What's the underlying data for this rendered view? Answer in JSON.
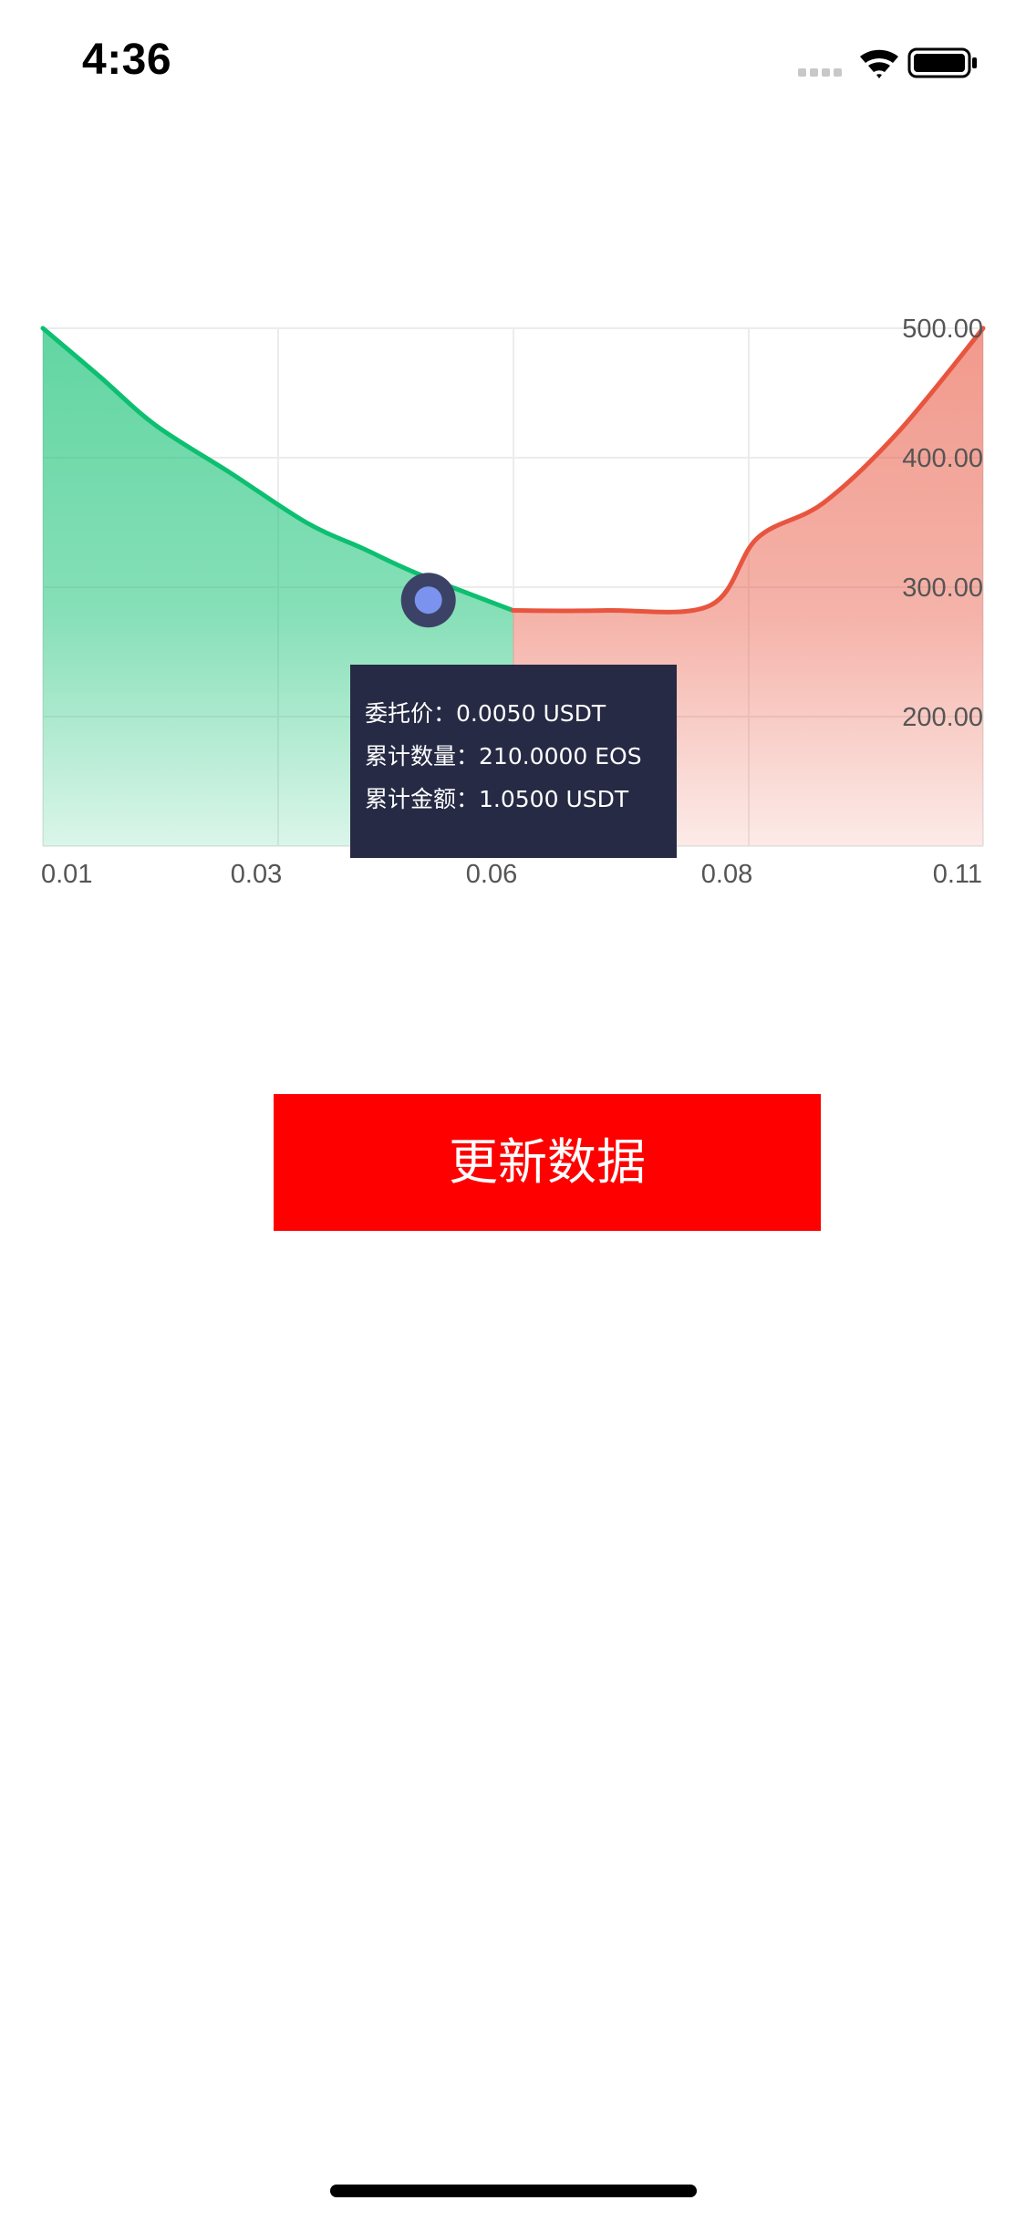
{
  "status_bar": {
    "time": "4:36",
    "icons": [
      "cellular-signal-icon",
      "wifi-icon",
      "battery-icon"
    ]
  },
  "tooltip": {
    "rows": [
      {
        "label": "委托价：",
        "value": "0.0050 USDT"
      },
      {
        "label": "累计数量：",
        "value": "210.0000 EOS"
      },
      {
        "label": "累计金额：",
        "value": "1.0500 USDT"
      }
    ]
  },
  "update_button": {
    "label": "更新数据"
  },
  "colors": {
    "bid": "#0dbf70",
    "ask": "#e8553f",
    "tooltip_bg": "#262a44",
    "marker": "#7b93ee",
    "button": "#ff0000"
  },
  "chart_data": {
    "type": "area",
    "x_tick_labels": [
      "0.01",
      "0.03",
      "0.06",
      "0.08",
      "0.11"
    ],
    "y_tick_labels": [
      "500.00",
      "400.00",
      "300.00",
      "200.00"
    ],
    "xlim": [
      0.01,
      0.11
    ],
    "ylim": [
      100,
      500
    ],
    "grid": true,
    "y_axis_position": "right",
    "series": [
      {
        "side": "bid",
        "color": "#0dbf70",
        "x": [
          0.01,
          0.016,
          0.022,
          0.03,
          0.038,
          0.044,
          0.05,
          0.06
        ],
        "y": [
          500,
          463,
          425,
          388,
          350,
          330,
          310,
          282
        ]
      },
      {
        "side": "ask",
        "color": "#e8553f",
        "x": [
          0.06,
          0.07,
          0.081,
          0.086,
          0.093,
          0.101,
          0.11
        ],
        "y": [
          282,
          282,
          286,
          338,
          365,
          420,
          500
        ]
      }
    ],
    "highlight": {
      "x": 0.051,
      "y": 290
    }
  }
}
